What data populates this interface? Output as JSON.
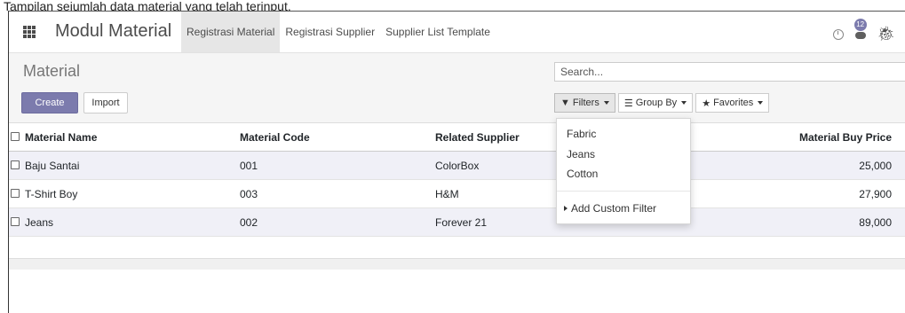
{
  "caption": "Tampilan sejumlah data material yang telah terinput.",
  "app": {
    "title": "Modul Material",
    "menu": [
      "Registrasi Material",
      "Registrasi Supplier",
      "Supplier List Template"
    ],
    "active_menu": "Registrasi Material",
    "notification_count": "12"
  },
  "control_panel": {
    "breadcrumb": "Material",
    "create_label": "Create",
    "import_label": "Import",
    "search_placeholder": "Search...",
    "filters_label": "Filters",
    "group_by_label": "Group By",
    "favorites_label": "Favorites"
  },
  "table": {
    "headers": [
      "Material Name",
      "Material Code",
      "Related Supplier",
      "Material Buy Price"
    ],
    "rows": [
      {
        "name": "Baju Santai",
        "code": "001",
        "supplier": "ColorBox",
        "price": "25,000"
      },
      {
        "name": "T-Shirt Boy",
        "code": "003",
        "supplier": "H&M",
        "price": "27,900"
      },
      {
        "name": "Jeans",
        "code": "002",
        "supplier": "Forever 21",
        "price": "89,000"
      }
    ]
  },
  "filters_dropdown": {
    "items": [
      "Fabric",
      "Jeans",
      "Cotton"
    ],
    "custom": "Add Custom Filter"
  },
  "colors": {
    "primary": "#7c7bad",
    "active_menu_bg": "#e6e6e6",
    "row_stripe": "#f0f0f7"
  }
}
